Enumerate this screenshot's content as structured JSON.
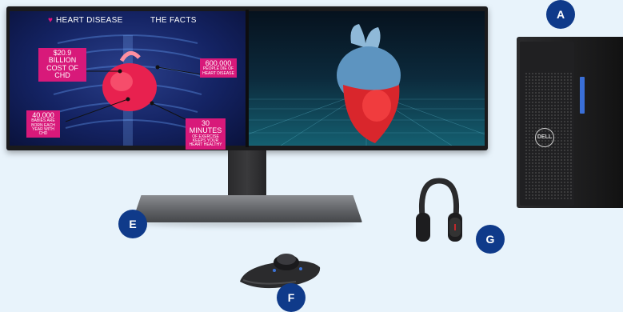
{
  "left_screen": {
    "title": "HEART DISEASE",
    "facts": "THE FACTS",
    "stat1_big": "$20.9 BILLION",
    "stat1_small": "COST OF CHD",
    "stat2_big": "600,000",
    "stat2_small": "PEOPLE DIE OF HEART DISEASE",
    "stat3_big": "40,000",
    "stat3_small": "BABIES ARE BORN EACH YEAR WITH CHD",
    "stat4_big": "30 MINUTES",
    "stat4_small": "OF EXERCISE KEEPS YOUR HEART HEALTHY"
  },
  "labels": {
    "a": "A",
    "e": "E",
    "f": "F",
    "g": "G"
  },
  "tower": {
    "logo": "DELL"
  },
  "colors": {
    "background": "#e8f3fb",
    "label_circle": "#0f3a8a",
    "accent_pink": "#d8197a"
  }
}
